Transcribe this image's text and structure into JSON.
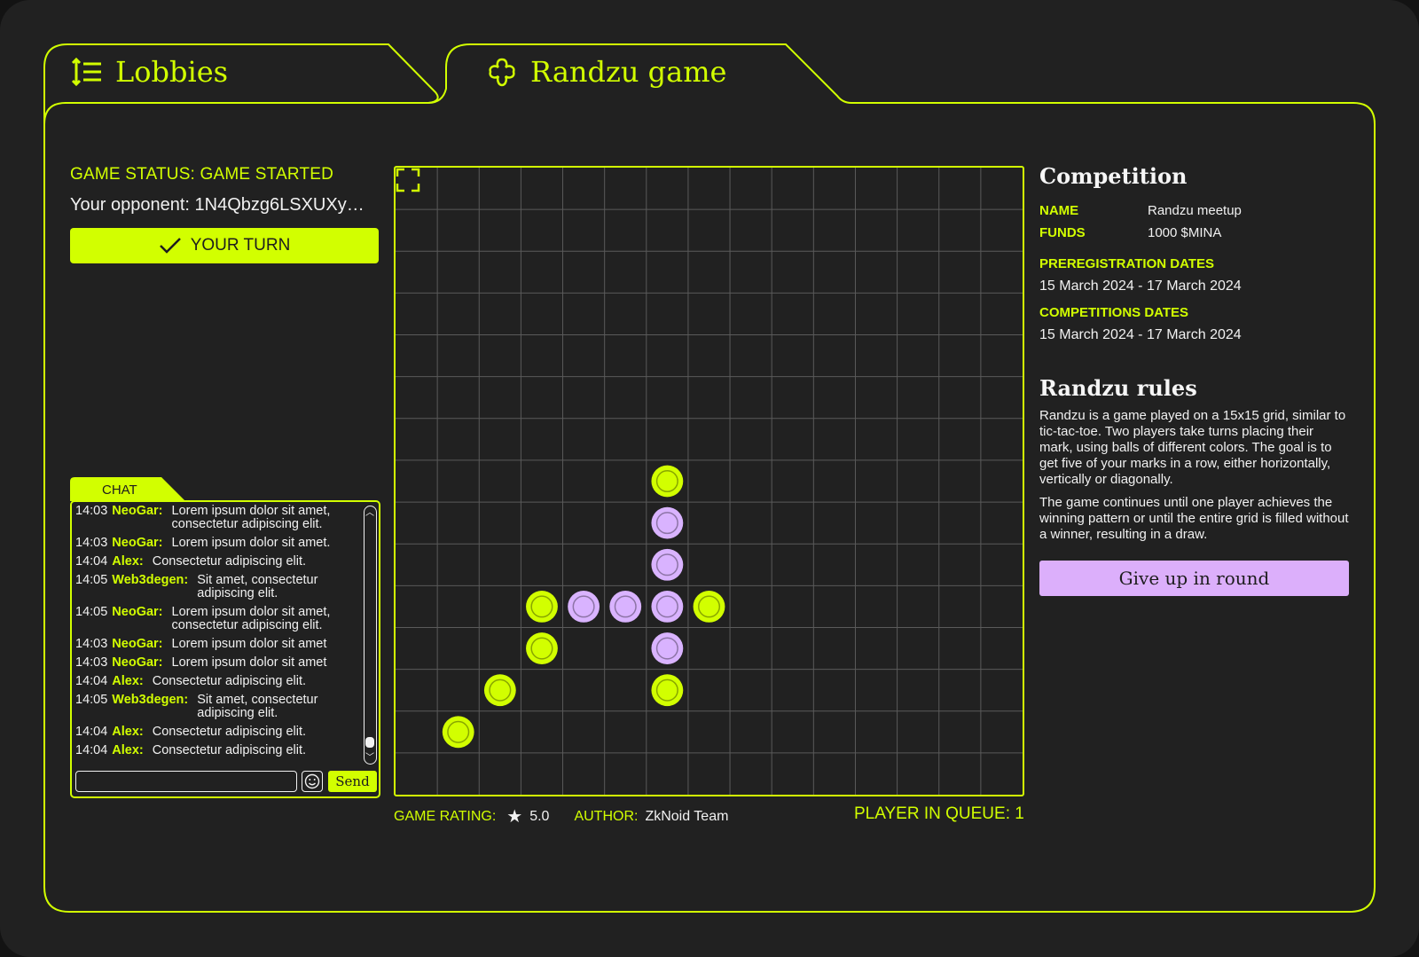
{
  "tabs": {
    "lobbies": "Lobbies",
    "game": "Randzu game"
  },
  "game": {
    "status": "GAME STATUS: GAME STARTED",
    "opponent": "Your opponent: 1N4Qbzg6LSXUXyX...",
    "turn_label": "YOUR TURN"
  },
  "chat": {
    "tab_label": "CHAT",
    "messages": [
      {
        "time": "14:03",
        "user": "NeoGar:",
        "text": "Lorem ipsum dolor sit amet, consectetur adipiscing elit."
      },
      {
        "time": "14:03",
        "user": "NeoGar:",
        "text": "Lorem ipsum dolor sit amet."
      },
      {
        "time": "14:04",
        "user": "Alex:",
        "text": "Consectetur adipiscing elit."
      },
      {
        "time": "14:05",
        "user": "Web3degen:",
        "text": "Sit amet, consectetur adipiscing elit."
      },
      {
        "time": "14:05",
        "user": "NeoGar:",
        "text": "Lorem ipsum dolor sit amet, consectetur adipiscing elit."
      },
      {
        "time": "14:03",
        "user": "NeoGar:",
        "text": "Lorem ipsum dolor sit amet"
      },
      {
        "time": "14:03",
        "user": "NeoGar:",
        "text": "Lorem ipsum dolor sit amet"
      },
      {
        "time": "14:04",
        "user": "Alex:",
        "text": "Consectetur adipiscing elit."
      },
      {
        "time": "14:05",
        "user": "Web3degen:",
        "text": "Sit amet, consectetur adipiscing elit."
      },
      {
        "time": "14:04",
        "user": "Alex:",
        "text": "Consectetur adipiscing elit."
      },
      {
        "time": "14:04",
        "user": "Alex:",
        "text": "Consectetur adipiscing elit."
      }
    ],
    "input_value": "",
    "send_label": "Send"
  },
  "board": {
    "size": 15,
    "colors": {
      "player1": "#d2ff00",
      "player2": "#d9b3ff",
      "grid": "#5a5a5a",
      "accent": "#d2ff00"
    },
    "stones": [
      {
        "row": 7,
        "col": 6,
        "player": 1
      },
      {
        "row": 8,
        "col": 6,
        "player": 2
      },
      {
        "row": 9,
        "col": 6,
        "player": 2
      },
      {
        "row": 10,
        "col": 3,
        "player": 1
      },
      {
        "row": 10,
        "col": 4,
        "player": 2
      },
      {
        "row": 10,
        "col": 5,
        "player": 2
      },
      {
        "row": 10,
        "col": 6,
        "player": 2
      },
      {
        "row": 10,
        "col": 7,
        "player": 1
      },
      {
        "row": 11,
        "col": 3,
        "player": 1
      },
      {
        "row": 11,
        "col": 6,
        "player": 2
      },
      {
        "row": 12,
        "col": 2,
        "player": 1
      },
      {
        "row": 12,
        "col": 6,
        "player": 1
      },
      {
        "row": 13,
        "col": 1,
        "player": 1
      }
    ]
  },
  "footer": {
    "rating_label": "GAME RATING:",
    "rating_value": "5.0",
    "author_label": "AUTHOR:",
    "author_value": "ZkNoid Team",
    "queue": "PLAYER IN QUEUE: 1"
  },
  "competition": {
    "title": "Competition",
    "name_label": "NAME",
    "name_value": "Randzu meetup",
    "funds_label": "FUNDS",
    "funds_value": "1000 $MINA",
    "prereg_label": "PREREGISTRATION DATES",
    "prereg_value": "15 March 2024 - 17 March 2024",
    "comp_label": "COMPETITIONS DATES",
    "comp_value": "15 March 2024 - 17 March 2024"
  },
  "rules": {
    "title": "Randzu rules",
    "p1": "Randzu is a game played on a 15x15 grid, similar to tic-tac-toe. Two players take turns placing their mark, using balls of different colors. The goal is to get five of your marks in a row, either horizontally, vertically or diagonally.",
    "p2": "The game continues until one player achieves the winning pattern or until the entire grid is filled without a winner, resulting in a draw.",
    "give_up": "Give up in round"
  }
}
